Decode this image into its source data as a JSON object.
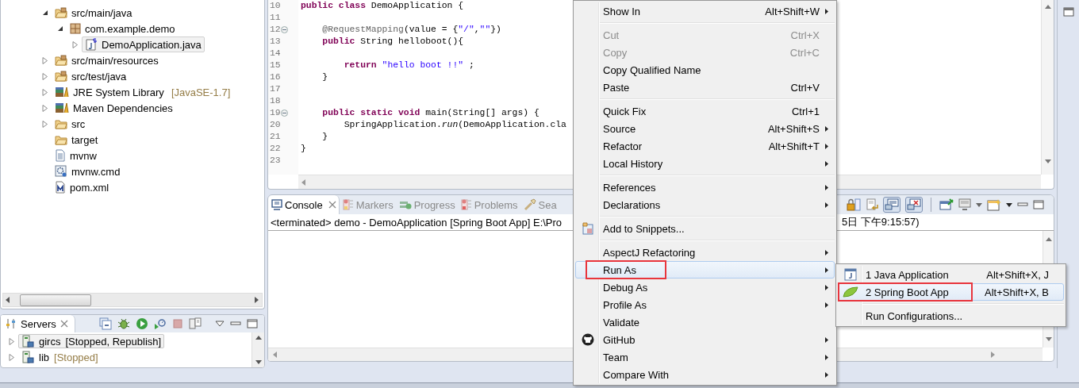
{
  "explorer": {
    "tree": [
      {
        "label": "src/main/java",
        "kind": "source-folder",
        "expanded": true,
        "selected": false,
        "children": [
          {
            "label": "com.example.demo",
            "kind": "package",
            "expanded": true,
            "selected": false,
            "children": [
              {
                "label": "DemoApplication.java",
                "kind": "java-file",
                "expanded": false,
                "selected": true
              }
            ]
          }
        ]
      },
      {
        "label": "src/main/resources",
        "kind": "source-folder",
        "expanded": false,
        "selected": false
      },
      {
        "label": "src/test/java",
        "kind": "source-folder",
        "expanded": false,
        "selected": false
      },
      {
        "label": "JRE System Library",
        "decoration": "[JavaSE-1.7]",
        "kind": "library",
        "expanded": false,
        "selected": false
      },
      {
        "label": "Maven Dependencies",
        "kind": "library",
        "expanded": false,
        "selected": false
      },
      {
        "label": "src",
        "kind": "folder",
        "expanded": false,
        "selected": false
      },
      {
        "label": "target",
        "kind": "folder",
        "selected": false
      },
      {
        "label": "mvnw",
        "kind": "file",
        "selected": false
      },
      {
        "label": "mvnw.cmd",
        "kind": "cmd-file",
        "selected": false
      },
      {
        "label": "pom.xml",
        "kind": "pom",
        "selected": false
      }
    ]
  },
  "servers": {
    "tab": {
      "label": "Servers"
    },
    "rows": [
      {
        "name": "gircs",
        "status": "[Stopped, Republish]",
        "expanded": false,
        "selected": true
      },
      {
        "name": "lib",
        "status": "[Stopped]",
        "expanded": false,
        "selected": false
      }
    ]
  },
  "editor": {
    "lines": [
      {
        "number": "10",
        "fold": false,
        "tokens": [
          {
            "kind": "keyword",
            "text": "public class"
          },
          {
            "kind": "plain",
            "text": " DemoApplication {"
          }
        ]
      },
      {
        "number": "11",
        "fold": false
      },
      {
        "number": "12",
        "fold": true,
        "tokens": [
          {
            "kind": "annotation",
            "text": "    @RequestMapping"
          },
          {
            "kind": "plain",
            "text": "(value = {"
          },
          {
            "kind": "string",
            "text": "\"/\""
          },
          {
            "kind": "plain",
            "text": ","
          },
          {
            "kind": "string",
            "text": "\"\""
          },
          {
            "kind": "plain",
            "text": "})"
          }
        ]
      },
      {
        "number": "13",
        "fold": false,
        "tokens": [
          {
            "kind": "keyword",
            "text": "    public"
          },
          {
            "kind": "plain",
            "text": " String helloboot(){"
          }
        ]
      },
      {
        "number": "14",
        "fold": false
      },
      {
        "number": "15",
        "fold": false,
        "tokens": [
          {
            "kind": "keyword",
            "text": "        return "
          },
          {
            "kind": "string",
            "text": "\"hello boot !!\""
          },
          {
            "kind": "plain",
            "text": " ;"
          }
        ]
      },
      {
        "number": "16",
        "fold": false,
        "tokens": [
          {
            "kind": "plain",
            "text": "    }"
          }
        ]
      },
      {
        "number": "17",
        "fold": false
      },
      {
        "number": "18",
        "fold": false
      },
      {
        "number": "19",
        "fold": true,
        "tokens": [
          {
            "kind": "keyword",
            "text": "    public static void"
          },
          {
            "kind": "plain",
            "text": " main(String[] args) {"
          }
        ]
      },
      {
        "number": "20",
        "fold": false,
        "tokens": [
          {
            "kind": "plain",
            "text": "        SpringApplication."
          },
          {
            "kind": "static",
            "text": "run"
          },
          {
            "kind": "plain",
            "text": "(DemoApplication.cla"
          }
        ]
      },
      {
        "number": "21",
        "fold": false,
        "tokens": [
          {
            "kind": "plain",
            "text": "    }"
          }
        ]
      },
      {
        "number": "22",
        "fold": false,
        "tokens": [
          {
            "kind": "plain",
            "text": "}"
          }
        ]
      },
      {
        "number": "23",
        "fold": false
      }
    ]
  },
  "console": {
    "tabs": [
      {
        "label": "Console",
        "kind": "console",
        "selected": true
      },
      {
        "label": "Markers",
        "kind": "markers",
        "selected": false
      },
      {
        "label": "Progress",
        "kind": "progress",
        "selected": false
      },
      {
        "label": "Problems",
        "kind": "problems",
        "selected": false
      },
      {
        "label": "Sea",
        "kind": "search",
        "selected": false
      }
    ],
    "header_left": "<terminated> demo - DemoApplication [Spring Boot App] E:\\Pro",
    "header_right": "5日 下午9:15:57)"
  },
  "context_menu": {
    "items": [
      {
        "kind": "plain",
        "label": "Show In",
        "shortcut": "Alt+Shift+W",
        "submenu": true,
        "disabled": false,
        "selected": false,
        "outlined": false
      },
      {
        "kind": "separator"
      },
      {
        "kind": "plain",
        "label": "Cut",
        "shortcut": "Ctrl+X",
        "submenu": false,
        "disabled": true,
        "selected": false,
        "outlined": false
      },
      {
        "kind": "plain",
        "label": "Copy",
        "shortcut": "Ctrl+C",
        "submenu": false,
        "disabled": true,
        "selected": false,
        "outlined": false
      },
      {
        "kind": "plain",
        "label": "Copy Qualified Name",
        "submenu": false,
        "disabled": false,
        "selected": false,
        "outlined": false
      },
      {
        "kind": "plain",
        "label": "Paste",
        "shortcut": "Ctrl+V",
        "submenu": false,
        "disabled": false,
        "selected": false,
        "outlined": false
      },
      {
        "kind": "separator"
      },
      {
        "kind": "plain",
        "label": "Quick Fix",
        "shortcut": "Ctrl+1",
        "submenu": false,
        "disabled": false,
        "selected": false,
        "outlined": false
      },
      {
        "kind": "plain",
        "label": "Source",
        "shortcut": "Alt+Shift+S",
        "submenu": true,
        "disabled": false,
        "selected": false,
        "outlined": false
      },
      {
        "kind": "plain",
        "label": "Refactor",
        "shortcut": "Alt+Shift+T",
        "submenu": true,
        "disabled": false,
        "selected": false,
        "outlined": false
      },
      {
        "kind": "plain",
        "label": "Local History",
        "submenu": true,
        "disabled": false,
        "selected": false,
        "outlined": false
      },
      {
        "kind": "separator"
      },
      {
        "kind": "plain",
        "label": "References",
        "submenu": true,
        "disabled": false,
        "selected": false,
        "outlined": false
      },
      {
        "kind": "plain",
        "label": "Declarations",
        "submenu": true,
        "disabled": false,
        "selected": false,
        "outlined": false
      },
      {
        "kind": "separator"
      },
      {
        "kind": "snippets",
        "label": "Add to Snippets...",
        "submenu": false,
        "disabled": false,
        "selected": false,
        "outlined": false
      },
      {
        "kind": "separator"
      },
      {
        "kind": "plain",
        "label": "AspectJ Refactoring",
        "submenu": true,
        "disabled": false,
        "selected": false,
        "outlined": false
      },
      {
        "kind": "plain",
        "label": "Run As",
        "submenu": true,
        "disabled": false,
        "selected": true,
        "outlined": true
      },
      {
        "kind": "plain",
        "label": "Debug As",
        "submenu": true,
        "disabled": false,
        "selected": false,
        "outlined": false
      },
      {
        "kind": "plain",
        "label": "Profile As",
        "submenu": true,
        "disabled": false,
        "selected": false,
        "outlined": false
      },
      {
        "kind": "plain",
        "label": "Validate",
        "submenu": false,
        "disabled": false,
        "selected": false,
        "outlined": false
      },
      {
        "kind": "github",
        "label": "GitHub",
        "submenu": true,
        "disabled": false,
        "selected": false,
        "outlined": false
      },
      {
        "kind": "plain",
        "label": "Team",
        "submenu": true,
        "disabled": false,
        "selected": false,
        "outlined": false
      },
      {
        "kind": "plain",
        "label": "Compare With",
        "submenu": true,
        "disabled": false,
        "selected": false,
        "outlined": false
      }
    ]
  },
  "submenu": {
    "items": [
      {
        "kind": "java-app",
        "label": "1 Java Application",
        "shortcut": "Alt+Shift+X, J",
        "submenu": false,
        "disabled": false,
        "selected": false,
        "outlined": false
      },
      {
        "kind": "spring",
        "label": "2 Spring Boot App",
        "shortcut": "Alt+Shift+X, B",
        "submenu": false,
        "disabled": false,
        "selected": true,
        "outlined": true
      },
      {
        "kind": "separator"
      },
      {
        "kind": "plain",
        "label": "Run Configurations...",
        "submenu": false,
        "disabled": false,
        "selected": false,
        "outlined": false
      }
    ]
  }
}
